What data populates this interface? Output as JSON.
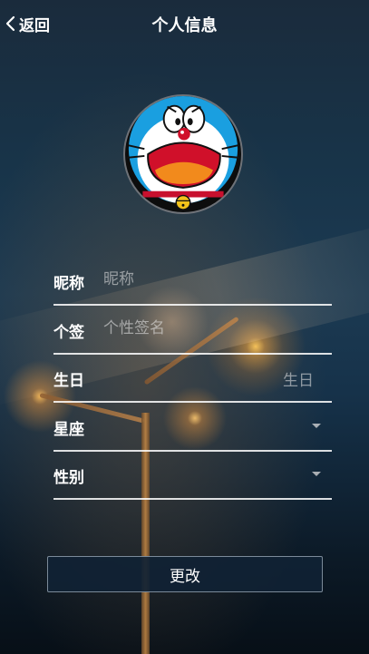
{
  "header": {
    "back_label": "返回",
    "title": "个人信息"
  },
  "avatar": {
    "description": "doraemon-avatar"
  },
  "form": {
    "nickname": {
      "label": "昵称",
      "placeholder": "昵称",
      "value": ""
    },
    "signature": {
      "label": "个签",
      "placeholder": "个性签名",
      "value": ""
    },
    "birthday": {
      "label": "生日",
      "value": "生日"
    },
    "constellation": {
      "label": "星座",
      "value": ""
    },
    "gender": {
      "label": "性别",
      "value": ""
    }
  },
  "actions": {
    "submit_label": "更改"
  },
  "colors": {
    "accent_button": "#102234",
    "text": "#ffffff",
    "placeholder": "#cfcfcf"
  }
}
